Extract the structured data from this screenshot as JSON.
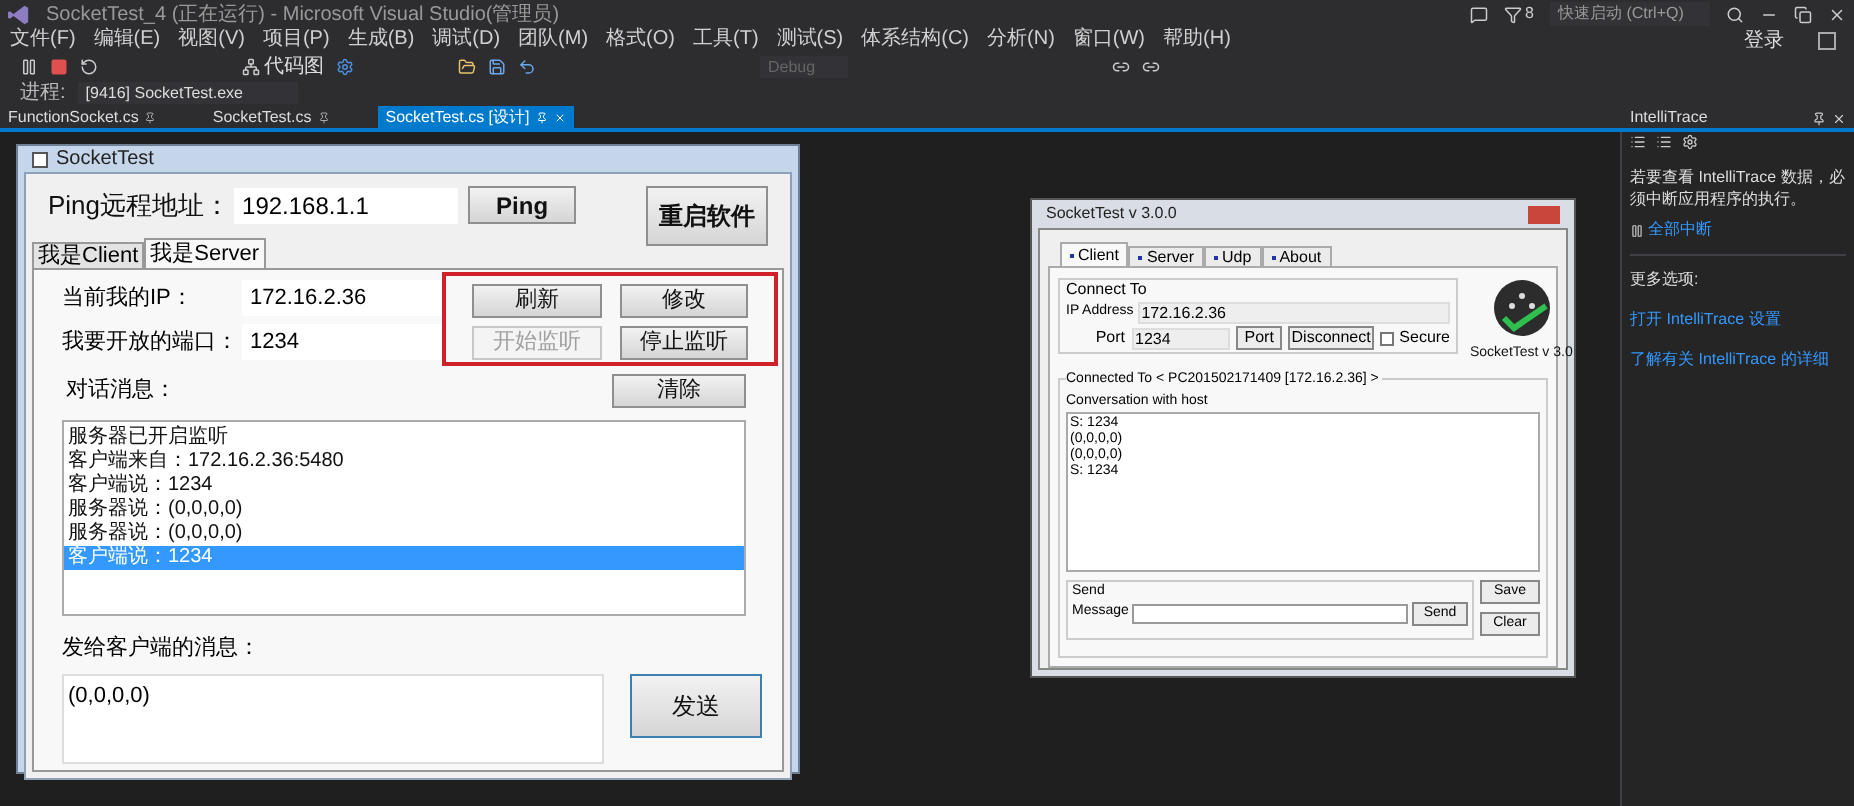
{
  "ide": {
    "title": "SocketTest_4 (正在运行) - Microsoft Visual Studio(管理员)",
    "menu": [
      "文件(F)",
      "编辑(E)",
      "视图(V)",
      "项目(P)",
      "生成(B)",
      "调试(D)",
      "团队(M)",
      "格式(O)",
      "工具(T)",
      "测试(S)",
      "体系结构(C)",
      "分析(N)",
      "窗口(W)",
      "帮助(H)"
    ],
    "code_map": "代码图",
    "config": "Debug",
    "process_label": "进程:",
    "process_value": "[9416] SocketTest.exe",
    "quick_launch": {
      "placeholder": "快速启动 (Ctrl+Q)"
    },
    "notification_count": "8",
    "sign_in": "登录",
    "doc_tabs": [
      {
        "label": "FunctionSocket.cs",
        "selected": false
      },
      {
        "label": "SocketTest.cs",
        "selected": false
      },
      {
        "label": "SocketTest.cs [设计]",
        "selected": true
      }
    ]
  },
  "app_window": {
    "title": "SocketTest",
    "ping_label": "Ping远程地址：",
    "ping_value": "192.168.1.1",
    "ping_button": "Ping",
    "restart_button": "重启软件",
    "tabs": [
      {
        "label": "我是Client",
        "selected": false
      },
      {
        "label": "我是Server",
        "selected": true
      }
    ],
    "fields": [
      {
        "label": "当前我的IP：",
        "value": "172.16.2.36"
      },
      {
        "label": "我要开放的端口：",
        "value": "1234"
      }
    ],
    "action_buttons": [
      {
        "label": "刷新",
        "disabled": false
      },
      {
        "label": "修改",
        "disabled": false
      },
      {
        "label": "开始监听",
        "disabled": true
      },
      {
        "label": "停止监听",
        "disabled": false
      }
    ],
    "conversation_label": "对话消息：",
    "clear_button": "清除",
    "messages": [
      {
        "text": "服务器已开启监听",
        "selected": false
      },
      {
        "text": "客户端来自：172.16.2.36:5480",
        "selected": false
      },
      {
        "text": "客户端说：1234",
        "selected": false
      },
      {
        "text": "服务器说：(0,0,0,0)",
        "selected": false
      },
      {
        "text": "服务器说：(0,0,0,0)",
        "selected": false
      },
      {
        "text": "客户端说：1234",
        "selected": true
      }
    ],
    "send_label": "发给客户端的消息：",
    "send_value": "(0,0,0,0)",
    "send_button": "发送"
  },
  "sockettest_window": {
    "title": "SocketTest v 3.0.0",
    "tabs": [
      {
        "label": "Client",
        "selected": true
      },
      {
        "label": "Server",
        "selected": false
      },
      {
        "label": "Udp",
        "selected": false
      },
      {
        "label": "About",
        "selected": false
      }
    ],
    "connect_group": "Connect To",
    "ip_label": "IP Address",
    "ip_value": "172.16.2.36",
    "port_label": "Port",
    "port_value": "1234",
    "port_button": "Port",
    "disconnect_button": "Disconnect",
    "secure": {
      "label": "Secure",
      "checked": false
    },
    "logo_caption": "SocketTest v 3.0",
    "connected_label": "Connected To <  PC201502171409 [172.16.2.36]  >",
    "conversation_label": "Conversation with host",
    "log": [
      "S: 1234",
      "(0,0,0,0)",
      "(0,0,0,0)",
      "S: 1234"
    ],
    "send_group": "Send",
    "message_label": "Message",
    "send_button": "Send",
    "save_button": "Save",
    "clear_button": "Clear"
  },
  "intellitrace": {
    "title": "IntelliTrace",
    "message": "若要查看 IntelliTrace 数据，必须中断应用程序的执行。",
    "break_link": "全部中断",
    "more_label": "更多选项:",
    "links": [
      "打开 IntelliTrace 设置",
      "了解有关 IntelliTrace 的详细"
    ]
  }
}
